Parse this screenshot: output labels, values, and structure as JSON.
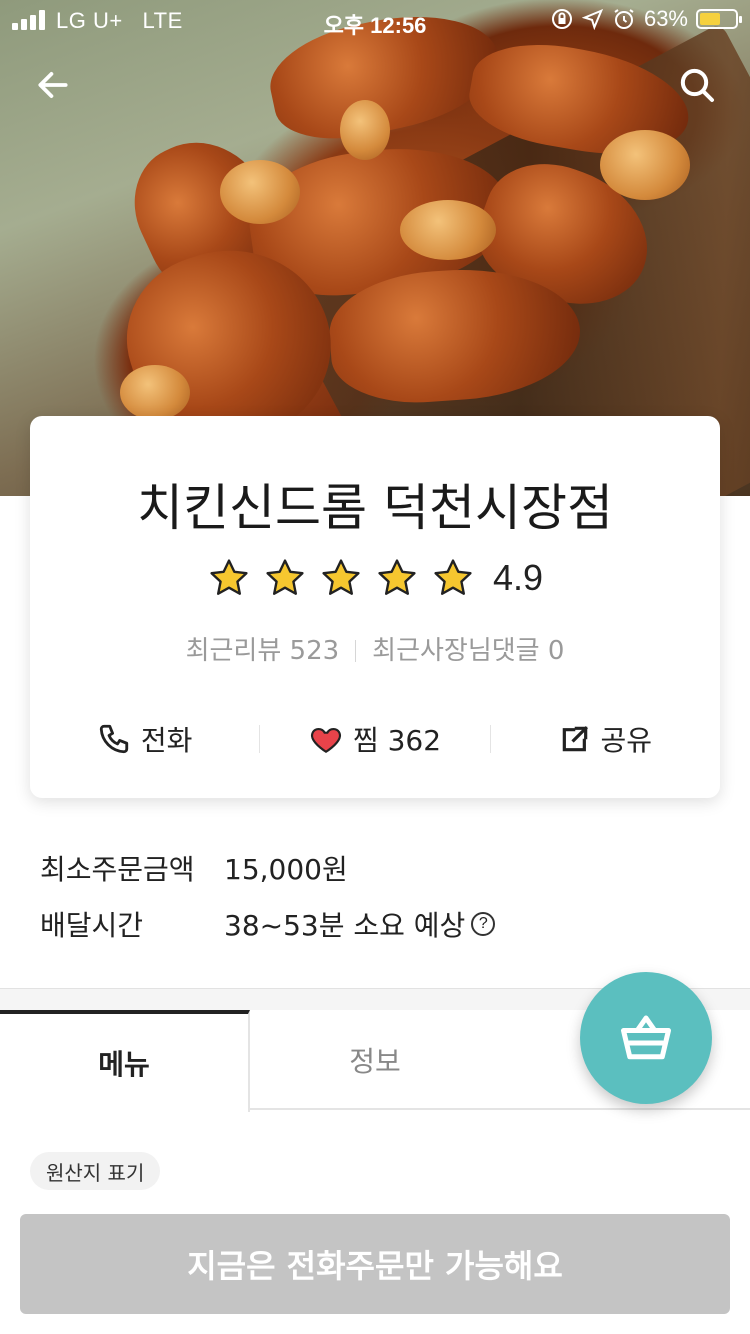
{
  "status_bar": {
    "carrier": "LG U+",
    "network": "LTE",
    "time": "오후 12:56",
    "battery": "63%",
    "battery_level": 0.63,
    "battery_color": "#f5d13e"
  },
  "nav": {
    "back_icon": "arrow-left-icon",
    "search_icon": "search-icon"
  },
  "shop": {
    "name": "치킨신드롬 덕천시장점",
    "rating": "4.9",
    "stars": 5,
    "recent_reviews": "최근리뷰 523",
    "owner_replies": "최근사장님댓글 0"
  },
  "actions": {
    "call": "전화",
    "favorite": "찜 362",
    "share": "공유"
  },
  "info": {
    "min_order_label": "최소주문금액",
    "min_order_value": "15,000원",
    "delivery_label": "배달시간",
    "delivery_value": "38~53분 소요 예상",
    "help_symbol": "?"
  },
  "tabs": {
    "menu": "메뉴",
    "info": "정보"
  },
  "origin_chip": "원산지 표기",
  "order_button": "지금은 전화주문만 가능해요",
  "colors": {
    "accent": "#5bbfbf",
    "star": "#f6c72f",
    "heart": "#e8434a",
    "disabled_button": "#c4c4c4"
  }
}
